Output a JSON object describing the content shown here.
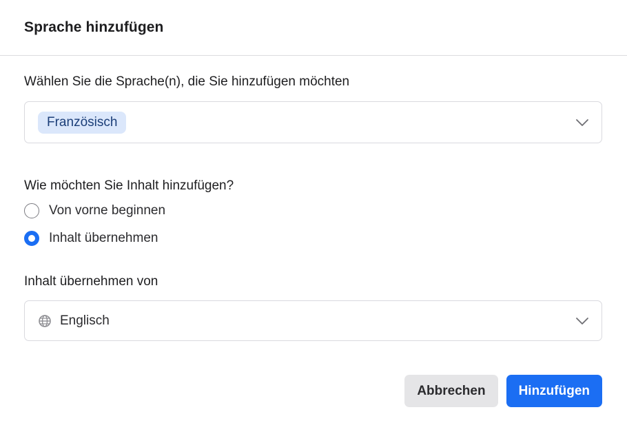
{
  "dialog": {
    "title": "Sprache hinzufügen"
  },
  "languages": {
    "label": "Wählen Sie die Sprache(n), die Sie hinzufügen möchten",
    "selected": [
      "Französisch"
    ]
  },
  "method": {
    "label": "Wie möchten Sie Inhalt hinzufügen?",
    "options": [
      {
        "label": "Von vorne beginnen",
        "checked": false
      },
      {
        "label": "Inhalt übernehmen",
        "checked": true
      }
    ]
  },
  "source": {
    "label": "Inhalt übernehmen von",
    "value": "Englisch",
    "icon": "globe-icon"
  },
  "footer": {
    "cancel_label": "Abbrechen",
    "add_label": "Hinzufügen"
  },
  "colors": {
    "accent": "#1b6ef3",
    "chip_bg": "#dbe7fb",
    "chip_text": "#1b3e78"
  }
}
